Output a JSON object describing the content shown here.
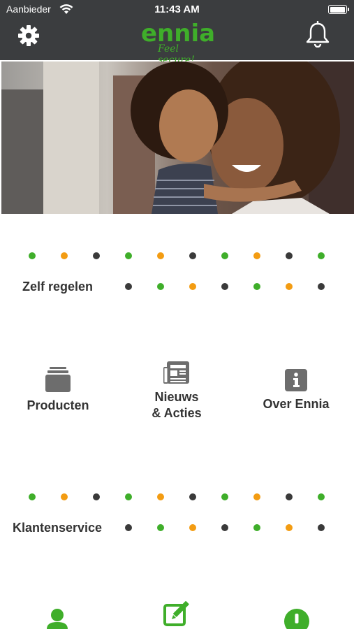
{
  "status_bar": {
    "carrier": "Aanbieder",
    "time": "11:43 AM",
    "battery_level": 1.0
  },
  "header": {
    "logo_text": "ennia",
    "logo_tagline": "Feel secure!",
    "settings_icon": "gear-icon",
    "notifications_icon": "bell-icon"
  },
  "hero": {
    "image": "photo-mother-and-child-hugging"
  },
  "colors": {
    "header_bg": "#3b3d3f",
    "brand_green": "#3fae2a",
    "dot_orange": "#f39c12",
    "dot_dark": "#3a3a3a",
    "icon_gray": "#6d6d6d"
  },
  "sections": {
    "self_service": {
      "label": "Zelf regelen",
      "tiles": [
        {
          "label_line1": "Producten",
          "label_line2": "",
          "icon": "folder-stack-icon"
        },
        {
          "label_line1": "Nieuws",
          "label_line2": "& Acties",
          "icon": "newspaper-icon"
        },
        {
          "label_line1": "Over Ennia",
          "label_line2": "",
          "icon": "info-icon"
        }
      ]
    },
    "customer_service": {
      "label": "Klantenservice",
      "icons": [
        "person-icon",
        "edit-icon",
        "alert-icon"
      ]
    }
  }
}
